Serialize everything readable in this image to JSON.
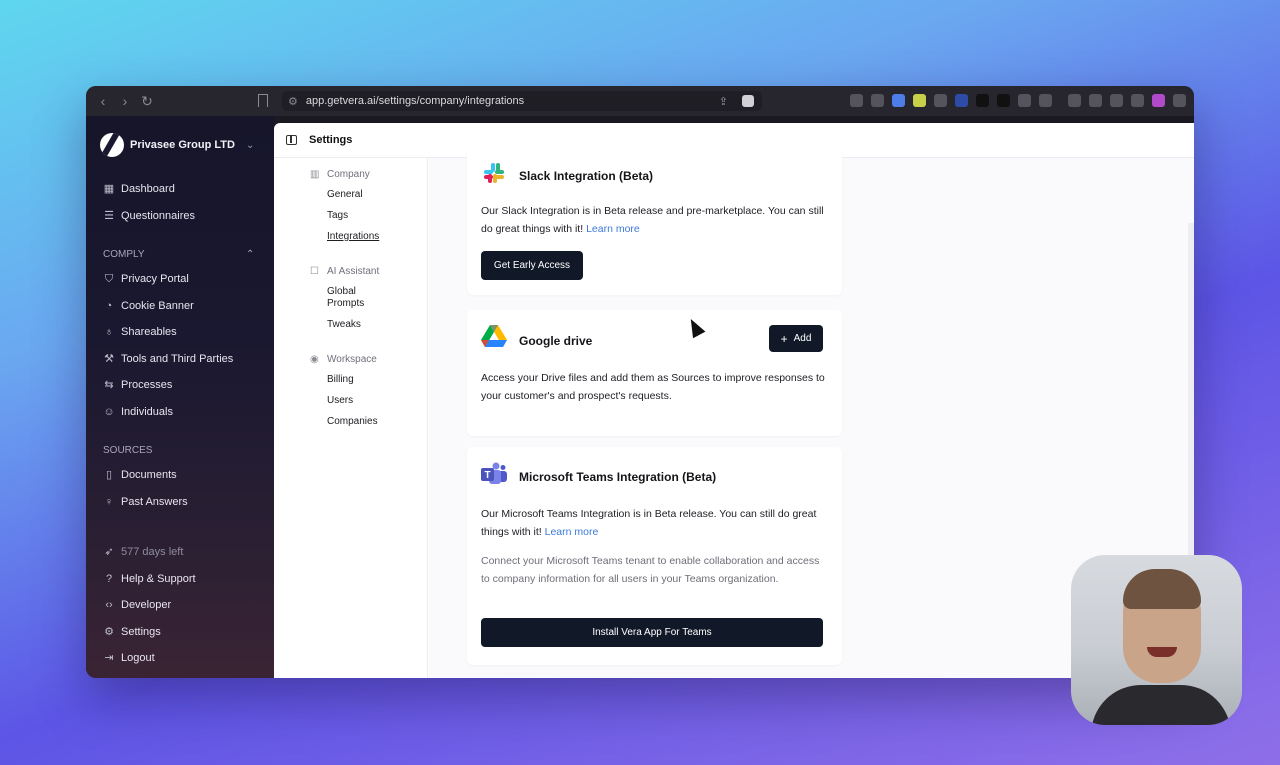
{
  "browser": {
    "url": "app.getvera.ai/settings/company/integrations"
  },
  "sidebar": {
    "org_name": "Privasee Group LTD",
    "top_items": [
      {
        "label": "Dashboard",
        "icon": "dashboard-icon"
      },
      {
        "label": "Questionnaires",
        "icon": "list-icon"
      }
    ],
    "comply_label": "COMPLY",
    "comply_items": [
      {
        "label": "Privacy Portal",
        "icon": "shield-icon"
      },
      {
        "label": "Cookie Banner",
        "icon": "cookie-icon"
      },
      {
        "label": "Shareables",
        "icon": "award-icon"
      },
      {
        "label": "Tools and Third Parties",
        "icon": "wrench-icon"
      },
      {
        "label": "Processes",
        "icon": "arrows-icon"
      },
      {
        "label": "Individuals",
        "icon": "users-icon"
      }
    ],
    "sources_label": "SOURCES",
    "sources_items": [
      {
        "label": "Documents",
        "icon": "document-icon"
      },
      {
        "label": "Past Answers",
        "icon": "lightbulb-icon"
      }
    ],
    "days_left": "577 days left",
    "bottom_items": [
      {
        "label": "Help & Support",
        "icon": "help-icon"
      },
      {
        "label": "Developer",
        "icon": "code-icon"
      },
      {
        "label": "Settings",
        "icon": "gear-icon"
      },
      {
        "label": "Logout",
        "icon": "logout-icon"
      }
    ]
  },
  "header": {
    "title": "Settings"
  },
  "subnav": {
    "company_label": "Company",
    "company_items": [
      "General",
      "Tags",
      "Integrations"
    ],
    "ai_label": "AI Assistant",
    "ai_items": [
      "Global Prompts",
      "Tweaks"
    ],
    "workspace_label": "Workspace",
    "workspace_items": [
      "Billing",
      "Users",
      "Companies"
    ]
  },
  "slack": {
    "title": "Slack Integration (Beta)",
    "text": "Our Slack Integration is in Beta release and pre-marketplace. You can still do great things with it!",
    "link": "Learn more",
    "button": "Get Early Access"
  },
  "gdrive": {
    "title": "Google drive",
    "button": "Add",
    "text": "Access your Drive files and add them as Sources to improve responses to your customer's and prospect's requests."
  },
  "teams": {
    "title": "Microsoft Teams Integration (Beta)",
    "text": "Our Microsoft Teams Integration is in Beta release. You can still do great things with it!",
    "link": "Learn more",
    "text2": "Connect your Microsoft Teams tenant to enable collaboration and access to company information for all users in your Teams organization.",
    "button": "Install Vera App For Teams"
  }
}
